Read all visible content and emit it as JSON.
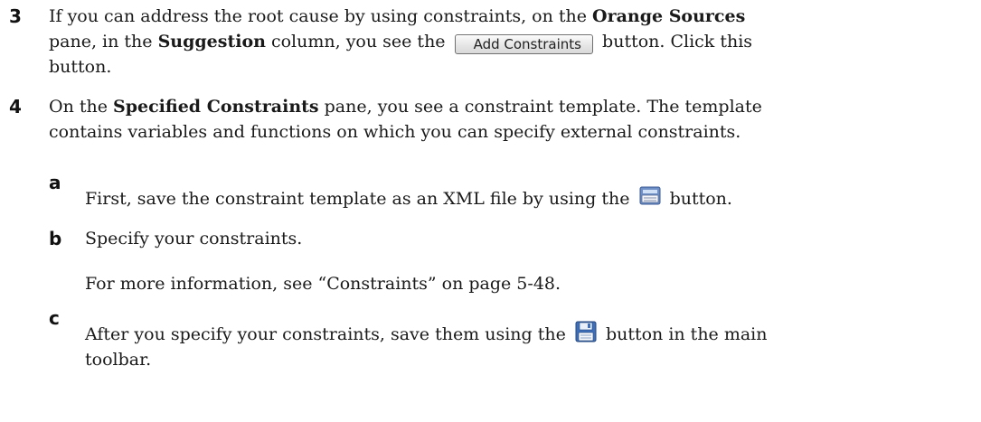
{
  "steps": [
    {
      "number": "3",
      "line1_a": "If you can address the root cause by using constraints, on the ",
      "line1_b": "Orange Sources",
      "line2_a": "pane, in the ",
      "line2_b": "Suggestion",
      "line2_c": " column, you see the ",
      "line2_d": " button. Click this",
      "line3": "button.",
      "button_label": "Add Constraints"
    },
    {
      "number": "4",
      "line1_a": "On the ",
      "line1_b": "Specified Constraints",
      "line1_c": " pane, you see a constraint template. The template",
      "line2": "contains variables and functions on which you can specify external constraints."
    }
  ],
  "substeps": [
    {
      "letter": "a",
      "text_a": "First, save the constraint template as an XML file by using the ",
      "icon": "export-icon",
      "text_b": " button."
    },
    {
      "letter": "b",
      "text": "Specify your constraints.",
      "note": "For more information, see “Constraints” on page 5-48."
    },
    {
      "letter": "c",
      "text_a": "After you specify your constraints, save them using the ",
      "icon": "save-icon",
      "text_b": " button in the main",
      "line2": "toolbar."
    }
  ]
}
